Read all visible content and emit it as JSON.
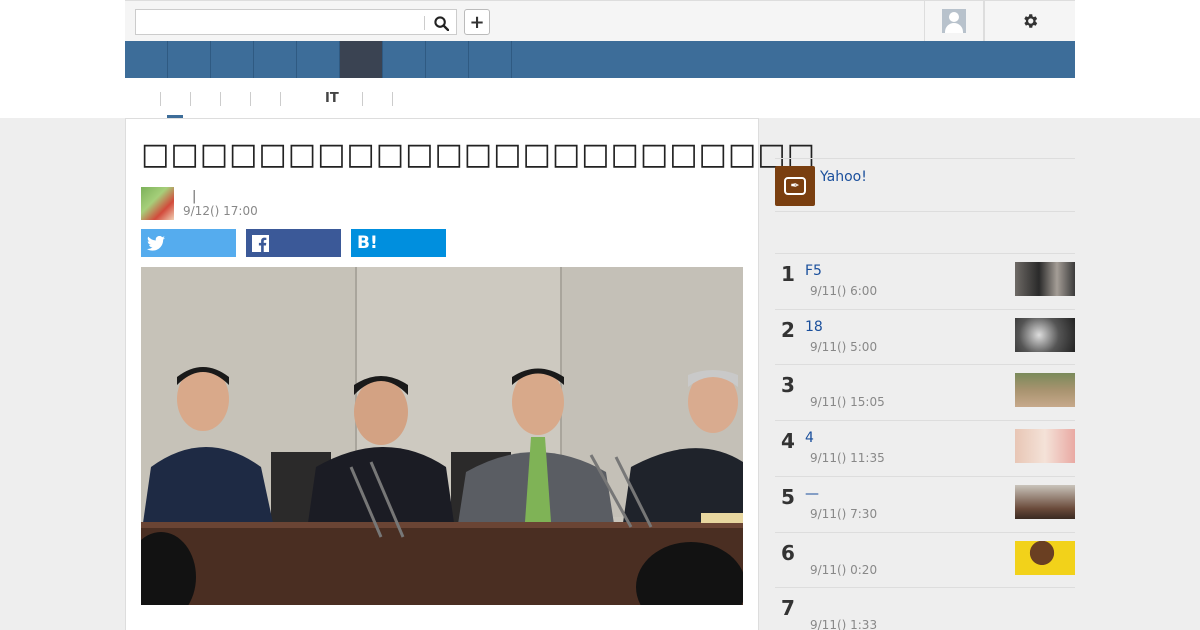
{
  "search": {
    "placeholder": ""
  },
  "subnav": {
    "items": [
      "",
      "",
      "",
      "",
      "",
      "IT",
      "",
      ""
    ]
  },
  "article": {
    "title": "□□□□□□□□□□□□□□□□□□□□□□□",
    "author_sep": "|",
    "time": "9/12() 17:00"
  },
  "share": {
    "twitter": "",
    "facebook": "",
    "hatena": "B!"
  },
  "sidebar": {
    "yahoo_link": "Yahoo!",
    "ranking": [
      {
        "rank": "1",
        "title": "F5",
        "time": "9/11() 6:00"
      },
      {
        "rank": "2",
        "title": "18",
        "time": "9/11() 5:00"
      },
      {
        "rank": "3",
        "title": "",
        "time": "9/11() 15:05"
      },
      {
        "rank": "4",
        "title": "4",
        "time": "9/11() 11:35"
      },
      {
        "rank": "5",
        "title": "—",
        "time": "9/11() 7:30"
      },
      {
        "rank": "6",
        "title": "",
        "time": "9/11() 0:20"
      },
      {
        "rank": "7",
        "title": "",
        "time": "9/11() 1:33"
      }
    ]
  }
}
